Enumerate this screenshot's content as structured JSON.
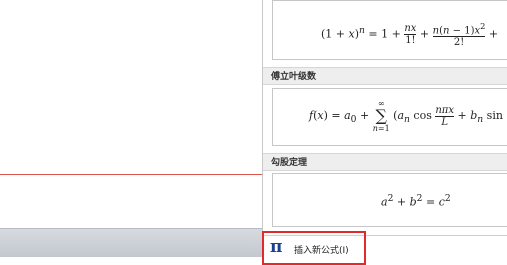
{
  "gallery": {
    "binomial": {
      "formula": "(1 + x)ⁿ = 1 + nx/1! + n(n − 1)x²/2! +"
    },
    "fourier": {
      "category": "傅立叶级数",
      "formula": "f(x) = a₀ + Σ_{n=1}^{∞} (aₙ cos nπx/L + bₙ sin"
    },
    "pythagorean": {
      "category": "勾股定理",
      "formula": "a² + b² = c²"
    }
  },
  "footer": {
    "insert_icon": "π",
    "insert_label": "插入新公式(I)"
  },
  "colors": {
    "highlight": "#e02b2b",
    "icon": "#1d3f8f"
  }
}
